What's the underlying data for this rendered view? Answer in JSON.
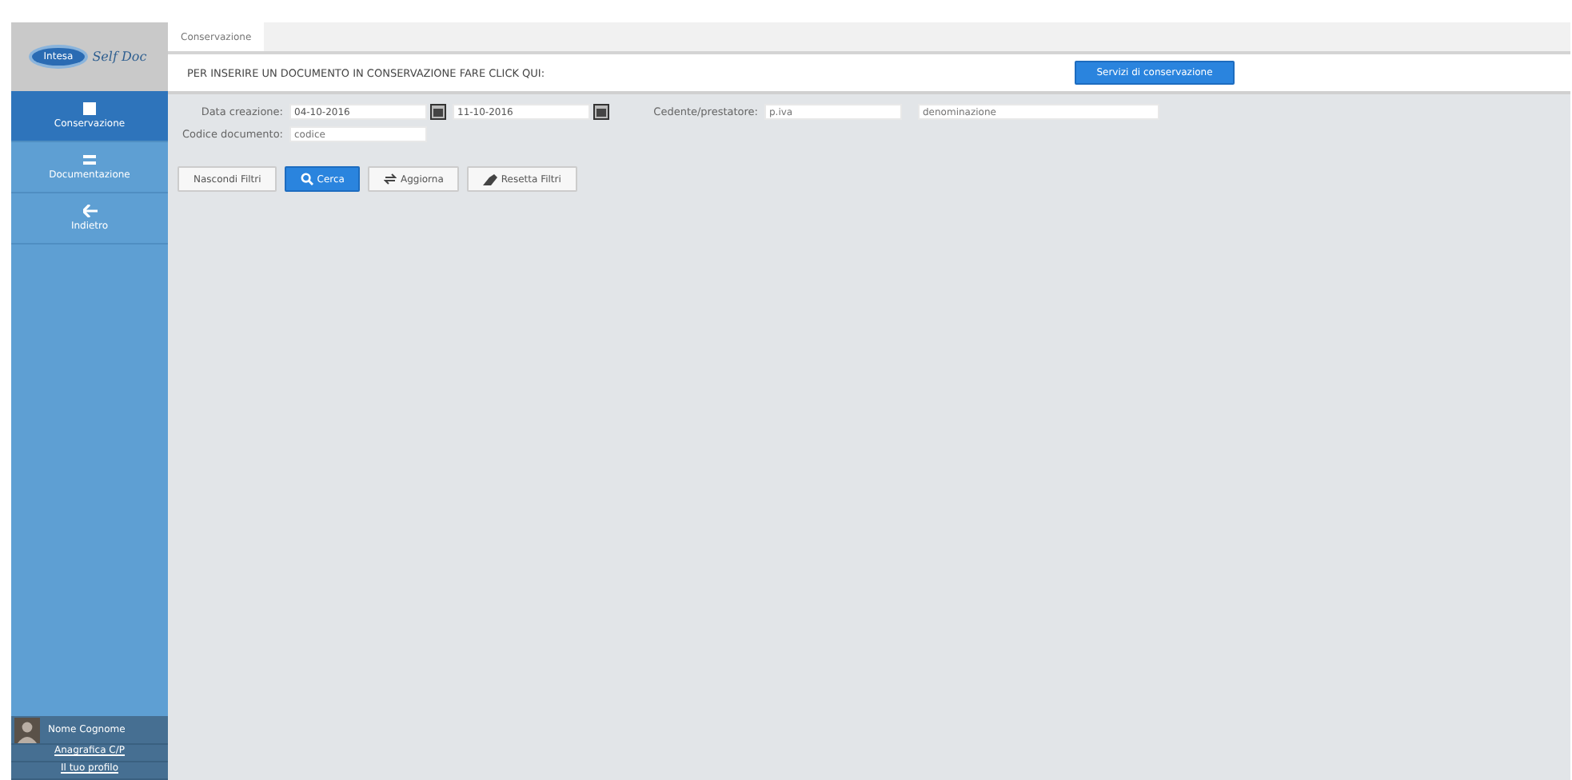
{
  "logo": {
    "badge": "Intesa",
    "name": "Self Doc"
  },
  "sidebar": {
    "items": [
      {
        "label": "Conservazione",
        "kind": "square",
        "selected": true
      },
      {
        "label": "Documentazione",
        "kind": "lines",
        "selected": false
      },
      {
        "label": "Indietro",
        "kind": "back",
        "selected": false
      }
    ],
    "user": {
      "name": "Nome Cognome",
      "links": [
        "Anagrafica C/P",
        "Il tuo profilo"
      ]
    }
  },
  "tabs": [
    {
      "label": "Conservazione",
      "selected": true
    }
  ],
  "banner": {
    "text": "PER INSERIRE UN DOCUMENTO IN CONSERVAZIONE FARE CLICK QUI:",
    "button": "Servizi di conservazione"
  },
  "filters": {
    "date_label": "Data creazione:",
    "date_from": "04-10-2016",
    "date_to": "11-10-2016",
    "party_label": "Cedente/prestatore:",
    "vat_placeholder": "p.iva",
    "name_placeholder": "denominazione",
    "code_label": "Codice documento:",
    "code_placeholder": "codice"
  },
  "buttons": [
    {
      "label": "Nascondi Filtri",
      "kind": "plain"
    },
    {
      "label": "Cerca",
      "kind": "search"
    },
    {
      "label": "Aggiorna",
      "kind": "refresh"
    },
    {
      "label": "Resetta Filtri",
      "kind": "reset"
    }
  ]
}
